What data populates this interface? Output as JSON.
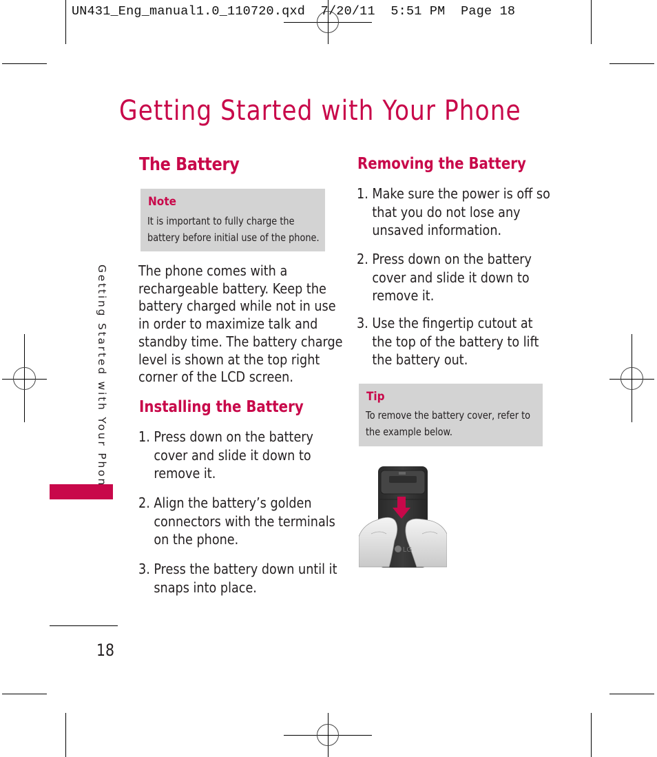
{
  "slug_line": "UN431_Eng_manual1.0_110720.qxd  7/20/11  5:51 PM  Page 18",
  "page_title": "Getting Started with Your Phone",
  "side_tab_label": "Getting Started with Your Phone",
  "accent_color": "#c8084a",
  "page_number": "18",
  "left_column": {
    "section_title": "The Battery",
    "note": {
      "label": "Note",
      "lines": [
        "It is important to fully charge the",
        "battery before initial use of the phone."
      ]
    },
    "intro_lines": [
      "The phone comes with a",
      "rechargeable battery. Keep the",
      "battery charged while not in use",
      "in order to maximize talk and",
      "standby time. The battery charge",
      "level is shown at the top right",
      "corner of the LCD screen."
    ],
    "installing": {
      "title": "Installing the Battery",
      "steps": [
        {
          "num": "1.",
          "lines": [
            "Press down on the battery",
            "cover and slide it down to",
            "remove it."
          ]
        },
        {
          "num": "2.",
          "lines": [
            "Align the battery’s golden",
            "connectors with the terminals",
            "on the phone."
          ]
        },
        {
          "num": "3.",
          "lines": [
            "Press the battery down until it",
            "snaps into place."
          ]
        }
      ]
    }
  },
  "right_column": {
    "removing": {
      "title": "Removing the Battery",
      "steps": [
        {
          "num": "1.",
          "lines": [
            "Make sure the power is off so",
            "that you do not lose any",
            "unsaved information."
          ]
        },
        {
          "num": "2.",
          "lines": [
            "Press down on the battery",
            "cover and slide it down to",
            "remove it."
          ]
        },
        {
          "num": "3.",
          "lines": [
            "Use the fingertip cutout at",
            "the top of the battery to lift",
            "the battery out."
          ]
        }
      ]
    },
    "tip": {
      "label": "Tip",
      "lines": [
        "To remove the battery cover, refer to",
        "the example below."
      ]
    },
    "illustration": {
      "description": "hands-sliding-battery-cover-down",
      "brand_text": "LG"
    }
  }
}
